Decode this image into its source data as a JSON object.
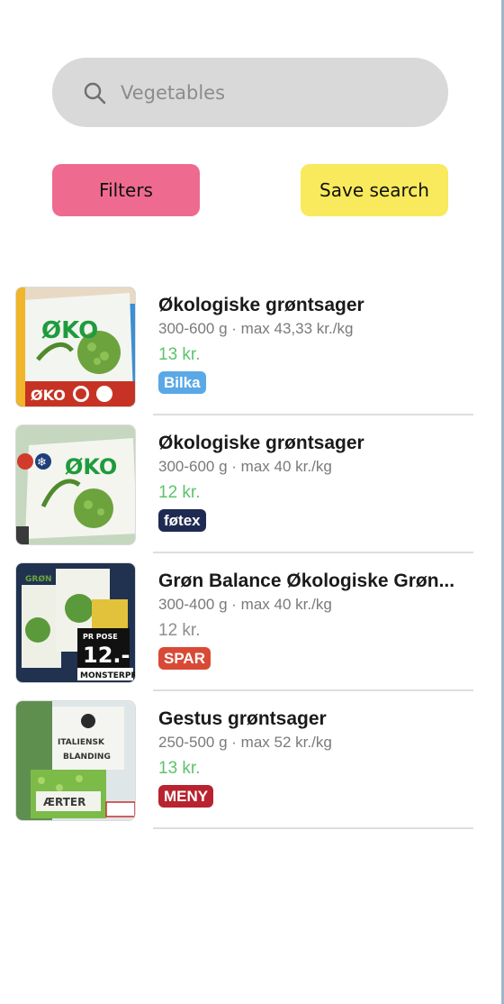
{
  "search": {
    "placeholder": "Vegetables",
    "icon": "search-icon"
  },
  "toolbar": {
    "filters_label": "Filters",
    "save_search_label": "Save search",
    "filters_color": "#ee6b8f",
    "save_search_color": "#f8ea5c"
  },
  "results": [
    {
      "title": "Økologiske grøntsager",
      "meta": "300-600 g · max 43,33 kr./kg",
      "price": "13 kr.",
      "store": "Bilka",
      "store_color": "#5aa8e6",
      "image_text": "ØKO"
    },
    {
      "title": "Økologiske grøntsager",
      "meta": "300-600 g · max 40 kr./kg",
      "price": "12 kr.",
      "store": "føtex",
      "store_color": "#1f2a52",
      "image_text": "ØKO"
    },
    {
      "title": "Grøn Balance Økologiske Grøn...",
      "meta": "300-400 g · max 40 kr./kg",
      "price": "12 kr.",
      "store": "SPAR",
      "store_color": "#d94a36",
      "image_text": "12.-",
      "image_subtext": "MONSTERPRIS"
    },
    {
      "title": "Gestus grøntsager",
      "meta": "250-500 g · max 52 kr./kg",
      "price": "13 kr.",
      "store": "MENY",
      "store_color": "#b8232f",
      "image_text": "ÆRTER"
    }
  ]
}
